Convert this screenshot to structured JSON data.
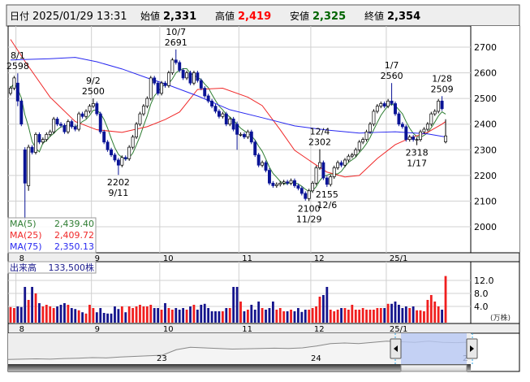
{
  "header": {
    "date_label": "日付",
    "datetime": "2025/01/29 13:31",
    "open_label": "始値",
    "open": "2,331",
    "high_label": "高値",
    "high": "2,419",
    "low_label": "安値",
    "low": "2,325",
    "close_label": "終値",
    "close": "2,354"
  },
  "legend": {
    "ma5_label": "MA(5)",
    "ma5_value": "2,439.40",
    "ma25_label": "MA(25)",
    "ma25_value": "2,409.72",
    "ma75_label": "MA(75)",
    "ma75_value": "2,350.13",
    "volume_label": "出来高",
    "volume_value": "133,500株"
  },
  "colors": {
    "up": "#ffffff",
    "down": "#0a1496",
    "ma5": "#2e7d32",
    "ma25": "#f02828",
    "ma75": "#2828f0",
    "vol_up": "#f01e1e",
    "vol_down": "#14148c"
  },
  "chart_data": {
    "type": "candlestick",
    "price_ticks": [
      "2700",
      "2600",
      "2500",
      "2400",
      "2300",
      "2200",
      "2100",
      "2000"
    ],
    "ylim": [
      2000,
      2700
    ],
    "month_labels": [
      {
        "label": "8",
        "start_index": 2
      },
      {
        "label": "9",
        "start_index": 23
      },
      {
        "label": "10",
        "start_index": 42
      },
      {
        "label": "11",
        "start_index": 64
      },
      {
        "label": "12",
        "start_index": 84
      },
      {
        "label": "25/1",
        "start_index": 105
      }
    ],
    "closes": [
      2540,
      2580,
      2490,
      2400,
      2170,
      2310,
      2290,
      2360,
      2330,
      2340,
      2360,
      2370,
      2420,
      2400,
      2395,
      2370,
      2410,
      2390,
      2380,
      2440,
      2430,
      2450,
      2470,
      2480,
      2440,
      2370,
      2330,
      2300,
      2280,
      2260,
      2240,
      2270,
      2265,
      2310,
      2350,
      2400,
      2440,
      2470,
      2500,
      2580,
      2560,
      2520,
      2560,
      2550,
      2600,
      2650,
      2640,
      2610,
      2580,
      2600,
      2560,
      2600,
      2570,
      2540,
      2510,
      2490,
      2470,
      2450,
      2430,
      2440,
      2400,
      2420,
      2380,
      2360,
      2360,
      2350,
      2370,
      2330,
      2280,
      2240,
      2250,
      2220,
      2170,
      2160,
      2165,
      2170,
      2175,
      2170,
      2180,
      2160,
      2150,
      2130,
      2110,
      2140,
      2170,
      2230,
      2250,
      2190,
      2165,
      2195,
      2230,
      2250,
      2240,
      2260,
      2275,
      2280,
      2300,
      2330,
      2340,
      2370,
      2400,
      2450,
      2470,
      2480,
      2470,
      2490,
      2480,
      2440,
      2400,
      2390,
      2340,
      2350,
      2340,
      2340,
      2370,
      2380,
      2400,
      2440,
      2450,
      2490,
      2460,
      2354
    ],
    "ohlc_overrides": {
      "2": [
        2560,
        2598,
        2470,
        2490
      ],
      "4": [
        2300,
        2310,
        2020,
        2170
      ],
      "5": [
        2160,
        2320,
        2140,
        2310
      ],
      "63": [
        2400,
        2410,
        2300,
        2360
      ],
      "121": [
        2331,
        2419,
        2325,
        2354
      ]
    },
    "ma25": [
      [
        0,
        2730
      ],
      [
        4,
        2645
      ],
      [
        11,
        2505
      ],
      [
        18,
        2410
      ],
      [
        24,
        2378
      ],
      [
        31,
        2368
      ],
      [
        38,
        2390
      ],
      [
        43,
        2418
      ],
      [
        47,
        2447
      ],
      [
        52,
        2535
      ],
      [
        59,
        2540
      ],
      [
        66,
        2505
      ],
      [
        70,
        2472
      ],
      [
        75,
        2378
      ],
      [
        79,
        2298
      ],
      [
        84,
        2250
      ],
      [
        88,
        2213
      ],
      [
        93,
        2194
      ],
      [
        97,
        2200
      ],
      [
        102,
        2266
      ],
      [
        107,
        2320
      ],
      [
        111,
        2345
      ],
      [
        116,
        2368
      ],
      [
        120,
        2400
      ],
      [
        121,
        2410
      ]
    ],
    "ma75": [
      [
        0,
        2650
      ],
      [
        11,
        2655
      ],
      [
        18,
        2660
      ],
      [
        24,
        2643
      ],
      [
        31,
        2615
      ],
      [
        38,
        2580
      ],
      [
        43,
        2557
      ],
      [
        52,
        2510
      ],
      [
        61,
        2456
      ],
      [
        70,
        2425
      ],
      [
        79,
        2393
      ],
      [
        88,
        2377
      ],
      [
        97,
        2365
      ],
      [
        102,
        2368
      ],
      [
        107,
        2370
      ],
      [
        116,
        2362
      ],
      [
        121,
        2350
      ]
    ],
    "annotations": [
      {
        "index": 2,
        "kind": "high",
        "date": "8/1",
        "value": "2598",
        "num": 2598
      },
      {
        "index": 23,
        "kind": "high",
        "date": "9/2",
        "value": "2500",
        "num": 2500
      },
      {
        "index": 30,
        "kind": "low",
        "date": "9/11",
        "value": "2202",
        "num": 2202
      },
      {
        "index": 46,
        "kind": "high",
        "date": "10/7",
        "value": "2691",
        "num": 2691
      },
      {
        "index": 83,
        "kind": "low",
        "date": "11/29",
        "value": "2100",
        "num": 2100
      },
      {
        "index": 86,
        "kind": "high",
        "date": "12/4",
        "value": "2302",
        "num": 2302
      },
      {
        "index": 88,
        "kind": "low",
        "date": "12/6",
        "value": "2155",
        "num": 2155
      },
      {
        "index": 106,
        "kind": "high",
        "date": "1/7",
        "value": "2560",
        "num": 2560
      },
      {
        "index": 113,
        "kind": "low",
        "date": "1/17",
        "value": "2318",
        "num": 2318
      },
      {
        "index": 120,
        "kind": "high",
        "date": "1/28",
        "value": "2509",
        "num": 2509
      }
    ],
    "volume_unit": "(万株)",
    "volume_ticks": [
      "12.0",
      "8.0",
      "4.0"
    ],
    "volumes": [
      3.8,
      3.5,
      4,
      3.8,
      10,
      6,
      10,
      8,
      5,
      4,
      4.5,
      4,
      3.5,
      4,
      4.5,
      5,
      4.5,
      3.5,
      3.2,
      2.8,
      2.2,
      1.8,
      4.5,
      3.5,
      2.2,
      3.5,
      2,
      1.8,
      1.8,
      4,
      3.2,
      4,
      2.2,
      4,
      3.5,
      4,
      4.5,
      4,
      4,
      4.5,
      3.5,
      3.5,
      3,
      5,
      3.5,
      3,
      3.5,
      3,
      3.5,
      3,
      4,
      4.5,
      3,
      4.5,
      4.8,
      3.5,
      2.5,
      2.5,
      2.5,
      2.5,
      3.5,
      3.5,
      10,
      10,
      5.5,
      2.5,
      3,
      4.5,
      3,
      5.5,
      3.5,
      3,
      3.5,
      5.5,
      3,
      3.5,
      2.5,
      2.5,
      3,
      2.5,
      3.5,
      2.3,
      3,
      3,
      3.5,
      4,
      7,
      7.5,
      10,
      3,
      2.5,
      3,
      3.5,
      3.5,
      3,
      4.5,
      3,
      3,
      3.5,
      3,
      3,
      3,
      3.5,
      3.5,
      3.5,
      4.8,
      4.8,
      5.5,
      4.5,
      3.5,
      4,
      3.5,
      4,
      2.8,
      2.8,
      2.5,
      6,
      7.5,
      5.5,
      4,
      3,
      13.35
    ]
  },
  "navigator": {
    "year_labels": [
      "23",
      "24",
      "2"
    ],
    "series": [
      1900,
      1905,
      1910,
      1905,
      1915,
      1920,
      1930,
      1925,
      1940,
      1950,
      1960,
      1970,
      2060,
      2100,
      2090,
      2080,
      2070,
      2075,
      2080,
      2085,
      2080,
      2090,
      2120,
      2160,
      2170,
      2160,
      2180,
      2200,
      2190,
      2180,
      2200,
      2180,
      2175,
      2185
    ]
  }
}
